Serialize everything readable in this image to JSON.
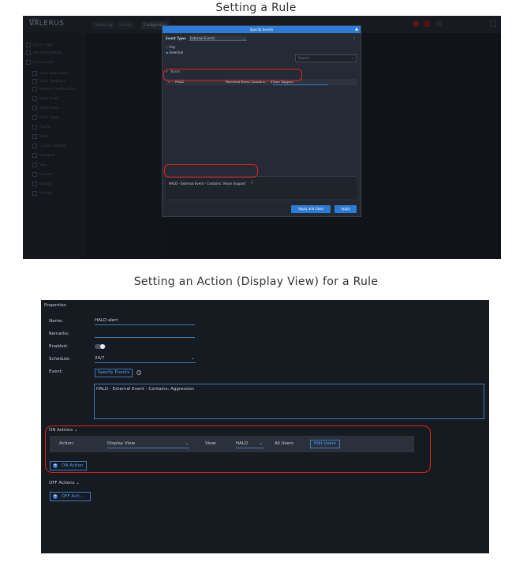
{
  "captions": {
    "top": "Setting a Rule",
    "bottom": "Setting an Action (Display View) for a Rule"
  },
  "shot1": {
    "brand_small": "VIDEO",
    "brand": "VALERUS",
    "tabs": [
      "Monitoring",
      "Events",
      "Configuration"
    ],
    "sidebar_items": [
      "Search Page",
      "Recording Settings",
      "Configuration",
      "Video Applications",
      "Video Templates",
      "Network Configuration",
      "Event Rules",
      "Action Rules",
      "Event Types",
      "Alarms",
      "Users",
      "Custom Defaults",
      "Scheduler",
      "View",
      "Licenses",
      "Backup",
      "Settings"
    ],
    "modal": {
      "title": "Specify Events",
      "event_type_label": "Event Type:",
      "event_type_value": "External Events",
      "radio_any": "Any",
      "radio_selected": "Selected",
      "search_placeholder": "Search...",
      "list_header": "Name",
      "row_name": "HALO",
      "row_condition": "Received Event Contains:",
      "row_value": "Vision Support",
      "selected_item": "HALO - External Event - Contains: Vision Support",
      "apply_close": "Apply and close",
      "apply": "Apply"
    },
    "colors": {
      "accent": "#2e7bd6",
      "highlight": "#e0201d"
    }
  },
  "shot2": {
    "title": "Properties",
    "fields": {
      "name_label": "Name:",
      "name_value": "HALO alert",
      "remarks_label": "Remarks:",
      "remarks_value": "",
      "enabled_label": "Enabled:",
      "schedule_label": "Schedule:",
      "schedule_value": "24/7",
      "event_label": "Event:",
      "specify_events": "Specify Events",
      "event_text": "HALO - External Event - Contains: Aggression"
    },
    "on_actions": {
      "header": "ON Actions",
      "action_label": "Action:",
      "action_value": "Display View",
      "view_label": "View:",
      "view_value": "HALO",
      "all_users": "All Users",
      "edit_users": "Edit Users",
      "add_button": "ON Action"
    },
    "off_actions": {
      "header": "OFF Actions",
      "add_button": "OFF Acti..."
    }
  }
}
